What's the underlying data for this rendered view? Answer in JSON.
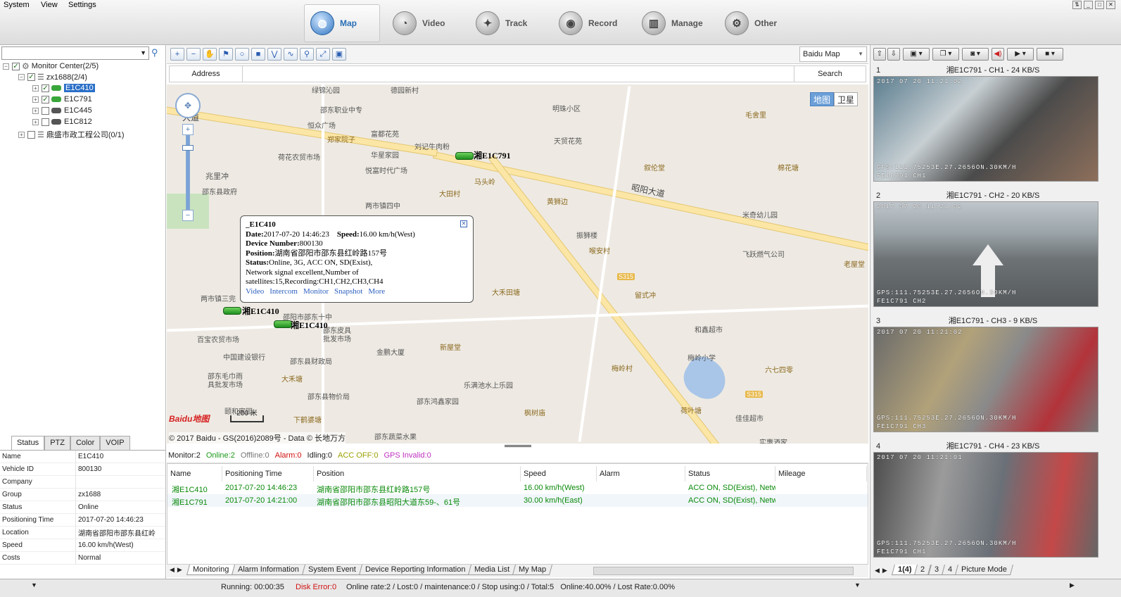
{
  "menu": [
    "System",
    "View",
    "Settings"
  ],
  "nav": [
    {
      "label": "Map",
      "icon": "globe-icon",
      "active": true
    },
    {
      "label": "Video",
      "icon": "video-icon"
    },
    {
      "label": "Track",
      "icon": "track-icon"
    },
    {
      "label": "Record",
      "icon": "record-icon"
    },
    {
      "label": "Manage",
      "icon": "manage-icon"
    },
    {
      "label": "Other",
      "icon": "other-icon"
    }
  ],
  "tree": {
    "root": "Monitor Center(2/5)",
    "group": "zx1688(2/4)",
    "vehicles": [
      "E1C410",
      "E1C791",
      "E1C445",
      "E1C812"
    ],
    "vehicle_prefix": "湘",
    "group2": "鼎盛市政工程公司(0/1)"
  },
  "status_tabs": [
    "Status",
    "PTZ",
    "Color",
    "VOIP"
  ],
  "status_rows": [
    {
      "k": "Name",
      "v": "E1C410"
    },
    {
      "k": "Vehicle ID",
      "v": "800130"
    },
    {
      "k": "Company",
      "v": ""
    },
    {
      "k": "Group",
      "v": "zx1688"
    },
    {
      "k": "Status",
      "v": "Online"
    },
    {
      "k": "Positioning Time",
      "v": "2017-07-20 14:46:23"
    },
    {
      "k": "Location",
      "v": "湖南省邵阳市邵东县红岭"
    },
    {
      "k": "Speed",
      "v": "16.00 km/h(West)"
    },
    {
      "k": "Costs",
      "v": "Normal"
    }
  ],
  "map": {
    "provider": "Baidu Map",
    "address_label": "Address",
    "search_label": "Search",
    "map_type_on": "地图",
    "map_type_off": "卫星",
    "scale": "200 米",
    "copyright": "© 2017 Baidu - GS(2016)2089号 - Data © 长地万方",
    "logo": "Baidu地图",
    "roads": [
      "昭阳大道",
      "大道",
      "S315",
      "S315"
    ],
    "pois": [
      "绿锦沁园",
      "德园新村",
      "邵东职业中专",
      "恒众广场",
      "富都花苑",
      "郑家院子",
      "刘记牛肉粉",
      "荷花农贸市场",
      "华星家园",
      "悦富时代广场",
      "兆里冲",
      "邵东县政府",
      "马头岭",
      "大田村",
      "两市镇四中",
      "明珠小区",
      "天贸花苑",
      "黄狮边",
      "毛舍里",
      "叙伦堂",
      "棉花塘",
      "米奇幼儿园",
      "振狮楼",
      "喉安村",
      "飞跃燃气公司",
      "老屋堂",
      "留式冲",
      "大禾田塘",
      "两市镇三完",
      "邵阳市邵东十中",
      "邵东皮具批发市场",
      "百宝农贸市场",
      "中国建设银行",
      "金鹏大厦",
      "邵东县财政局",
      "新屋堂",
      "和鑫超市",
      "梅岭小学",
      "梅岭村",
      "六七四零",
      "邵东毛巾雨具批发市场",
      "大禾塘",
      "乐满池水上乐园",
      "邵东县物价局",
      "颐和家园",
      "邵东鸿鑫家园",
      "枫树庙",
      "荷叶塘",
      "下鹤婆塘",
      "佳佳超市",
      "邵东蔬菜水果",
      "实惠酒家"
    ]
  },
  "markers": [
    {
      "label": "湘E1C791"
    },
    {
      "label": "湘E1C410"
    },
    {
      "label": "湘E1C410"
    }
  ],
  "popup": {
    "title": "_E1C410",
    "date_label": "Date:",
    "date": "2017-07-20 14:46:23",
    "speed_label": "Speed:",
    "speed": "16.00 km/h(West)",
    "device_label": "Device Number:",
    "device": "800130",
    "position_label": "Position:",
    "position": "湖南省邵阳市邵东县红岭路157号",
    "status_label": "Status:",
    "status": "Online, 3G, ACC ON, SD(Exist), Network signal excellent,Number of satellites:15,Recording:CH1,CH2,CH3,CH4",
    "links": [
      "Video",
      "Intercom",
      "Monitor",
      "Snapshot",
      "More"
    ]
  },
  "summary": [
    {
      "text": "Monitor:2",
      "color": "#222222"
    },
    {
      "text": "Online:2",
      "color": "#1a9a1a"
    },
    {
      "text": "Offline:0",
      "color": "#777777"
    },
    {
      "text": "Alarm:0",
      "color": "#d01010"
    },
    {
      "text": "Idling:0",
      "color": "#222222"
    },
    {
      "text": "ACC OFF:0",
      "color": "#9aa000"
    },
    {
      "text": "GPS Invalid:0",
      "color": "#c030c0"
    }
  ],
  "grid": {
    "columns": [
      "Name",
      "Positioning Time",
      "Position",
      "Speed",
      "Alarm",
      "Status",
      "Mileage"
    ],
    "rows": [
      [
        "湘E1C410",
        "2017-07-20 14:46:23",
        "湖南省邵阳市邵东县红岭路157号",
        "16.00 km/h(West)",
        "",
        "ACC ON, SD(Exist), Netwo",
        ""
      ],
      [
        "湘E1C791",
        "2017-07-20 14:21:00",
        "湖南省邵阳市邵东县昭阳大道东59-、61号",
        "30.00 km/h(East)",
        "",
        "ACC ON, SD(Exist), Netwo",
        ""
      ]
    ]
  },
  "bottom_tabs": [
    "Monitoring",
    "Alarm Information",
    "System Event",
    "Device Reporting Information",
    "Media List",
    "My Map"
  ],
  "cameras": [
    {
      "num": "1",
      "title": "湘E1C791 - CH1 - 24 KB/S",
      "time": "2017 07 20 11:21:02",
      "gps": "GPS:111.75253E.27.2656ON.30KM/H",
      "id": "FE1C791  CH1"
    },
    {
      "num": "2",
      "title": "湘E1C791 - CH2 - 20 KB/S",
      "time": "2017 07 20 11:21:02",
      "gps": "GPS:111.75253E.27.2656ON.30KM/H",
      "id": "FE1C791  CH2"
    },
    {
      "num": "3",
      "title": "湘E1C791 - CH3 - 9 KB/S",
      "time": "2017 07 20 11:21:02",
      "gps": "GPS:111.75253E.27.2656ON.30KM/H",
      "id": "FE1C791  CH3"
    },
    {
      "num": "4",
      "title": "湘E1C791 - CH4 - 23 KB/S",
      "time": "2017 07 20 11:21:01",
      "gps": "GPS:111.75253E.27.2656ON.30KM/H",
      "id": "FE1C791  CH1"
    }
  ],
  "video_tabs": [
    "1(4)",
    "2",
    "3",
    "4",
    "Picture Mode"
  ],
  "statusbar": {
    "running": "Running: 00:00:35",
    "disk": "Disk Error:0",
    "rest": "Online rate:2 / Lost:0 / maintenance:0 / Stop using:0 / Total:5   Online:40.00% / Lost Rate:0.00%"
  }
}
